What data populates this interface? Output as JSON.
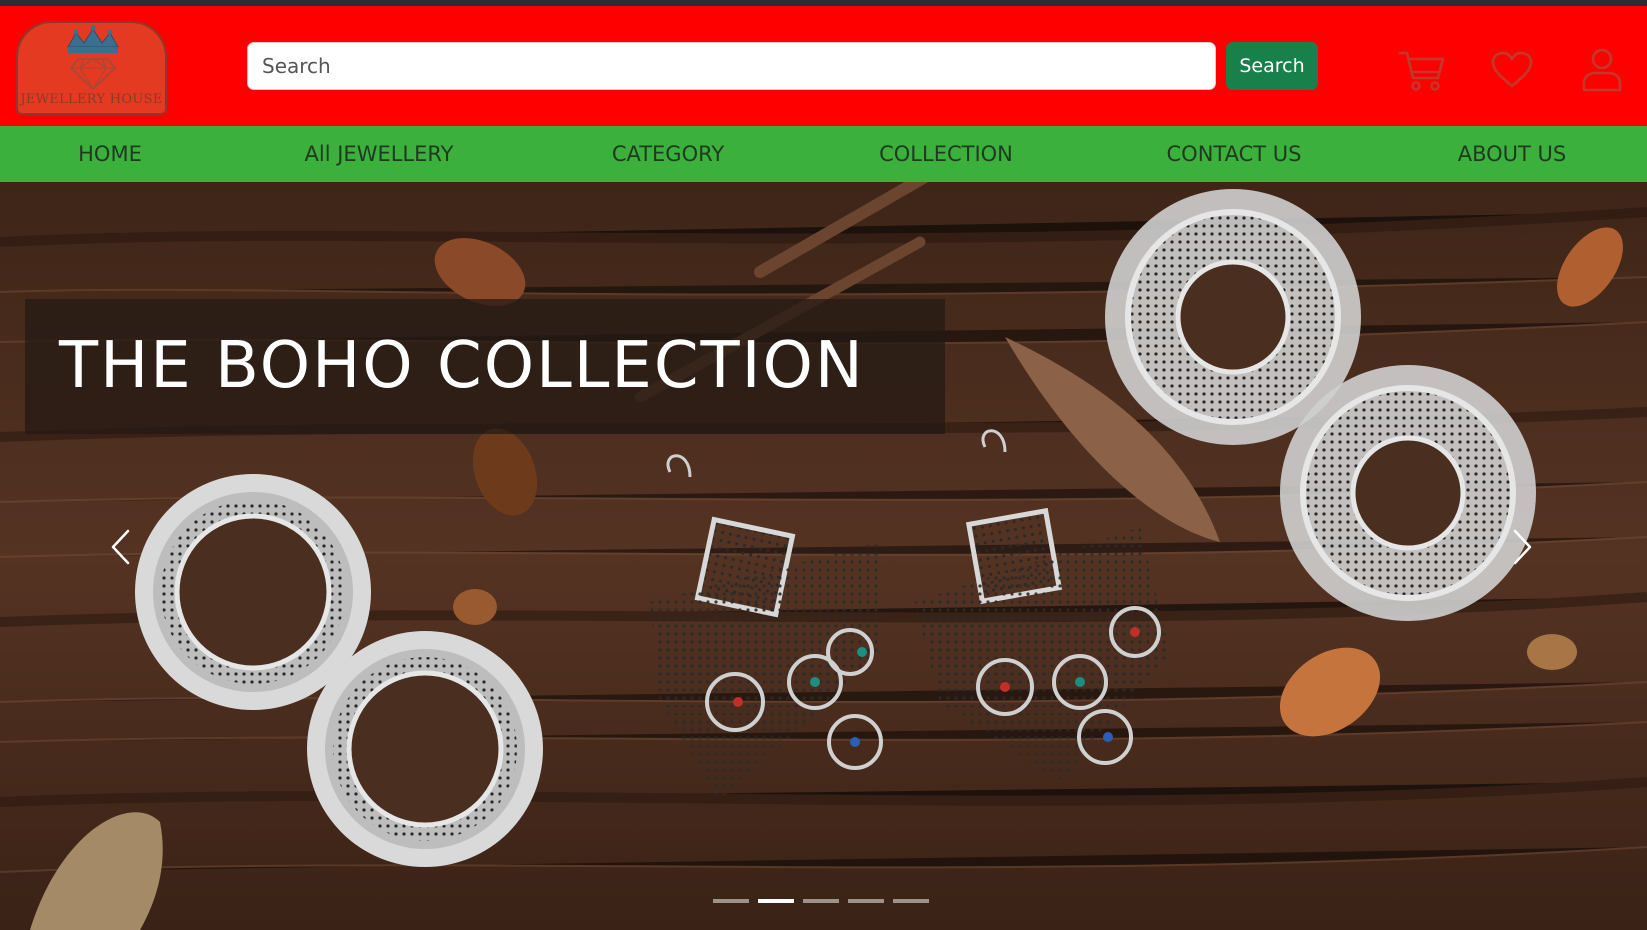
{
  "header": {
    "logo_text": "JEWELLERY HOUSE",
    "search_placeholder": "Search",
    "search_button_label": "Search",
    "icons": [
      "cart-icon",
      "heart-icon",
      "user-icon"
    ],
    "colors": {
      "header_bg": "#ff0000",
      "search_button_bg": "#17804b",
      "icon": "#c0392b"
    }
  },
  "nav": {
    "items": [
      {
        "label": "HOME"
      },
      {
        "label": "All JEWELLERY"
      },
      {
        "label": "CATEGORY"
      },
      {
        "label": "COLLECTION"
      },
      {
        "label": "CONTACT US"
      },
      {
        "label": "ABOUT US"
      }
    ],
    "colors": {
      "bg": "#3cb03c",
      "text": "#1f3a1f"
    }
  },
  "hero": {
    "caption": "THE BOHO COLLECTION",
    "prev_icon": "chevron-left-icon",
    "next_icon": "chevron-right-icon",
    "slide_count": 5,
    "active_slide": 2
  }
}
